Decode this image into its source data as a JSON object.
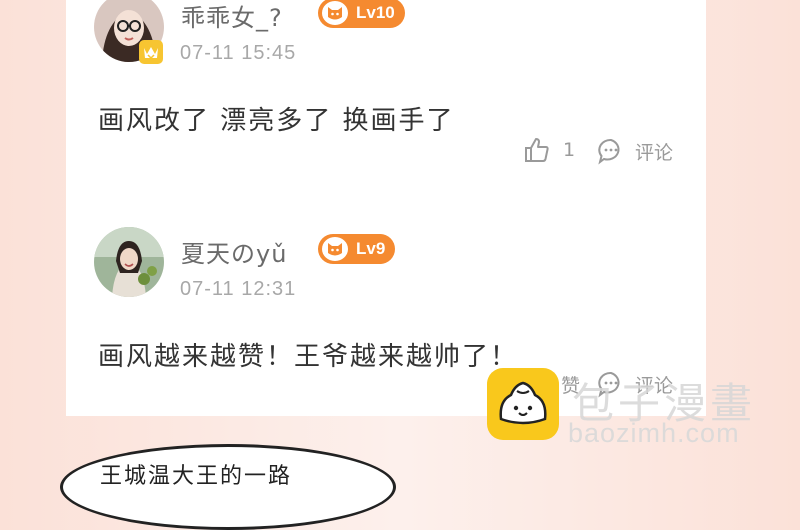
{
  "comments": [
    {
      "username": "乖乖女_?",
      "level": "Lv10",
      "time": "07-11 15:45",
      "text": "画风改了 漂亮多了 换画手了",
      "like_count": "1",
      "comment_label": "评论"
    },
    {
      "username": "夏天のyǔ",
      "level": "Lv9",
      "time": "07-11 12:31",
      "text": "画风越来越赞！王爷越来越帅了！",
      "like_label": "赞",
      "comment_label": "评论"
    }
  ],
  "bubble_text": "王城温大王的一路",
  "watermark": {
    "title": "包子漫畫",
    "url": "baozimh.com"
  },
  "colors": {
    "level_badge": "#f58a30",
    "vip_crown": "#f7c531",
    "watermark_logo": "#f9c81c"
  }
}
